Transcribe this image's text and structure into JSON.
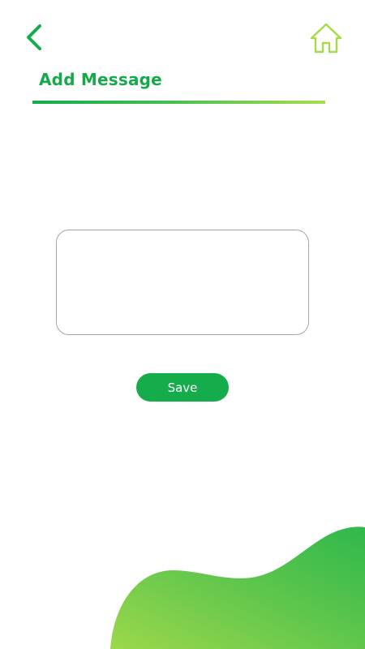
{
  "header": {
    "back_icon": "chevron-left-icon",
    "home_icon": "home-icon",
    "title": "Add Message"
  },
  "message_input": {
    "value": "",
    "placeholder": ""
  },
  "actions": {
    "save_label": "Save"
  },
  "colors": {
    "primary_green": "#15ad4b",
    "home_icon_lime": "#a6da4a",
    "underline_gradient": [
      "#14ab4b",
      "#a9dd4f"
    ],
    "wave_gradient": [
      "#9cd84b",
      "#2fb84b"
    ],
    "input_border": "#a6a6a6"
  }
}
